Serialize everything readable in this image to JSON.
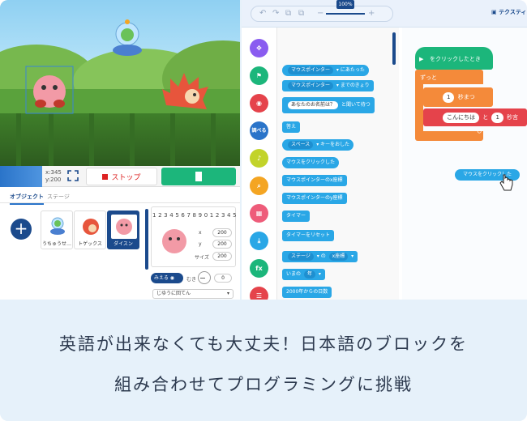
{
  "stage": {
    "coord_x": "x:345",
    "coord_y": "y:200",
    "stop_label": "ストップ"
  },
  "panel_tabs": [
    "オブジェクト",
    "ステージ"
  ],
  "sprites": [
    {
      "name": "うちゅうせ…"
    },
    {
      "name": "トゲックス"
    },
    {
      "name": "ダイスン"
    }
  ],
  "properties": {
    "digits": "1 2 3 4 5 6 7 8 9 0 1 2 3 4 5",
    "x_label": "x",
    "x_value": "200",
    "y_label": "y",
    "y_value": "200",
    "size_label": "サイズ",
    "size_value": "200",
    "show_label": "みえる",
    "direction_label": "むき",
    "direction_value": "0",
    "rotation_style": "じゆうに回てん"
  },
  "toolbar": {
    "zoom": "100%",
    "undo": "↶",
    "redo": "↷",
    "copy": "⧉",
    "minus": "−",
    "plus": "+",
    "text_mode": "テクスティ"
  },
  "categories": [
    {
      "label": "✥",
      "color": "#8a5cf0"
    },
    {
      "label": "⚑",
      "color": "#1cb67b"
    },
    {
      "label": "◉",
      "color": "#e5434b"
    },
    {
      "label": "調べる",
      "color": "#2a74c9"
    },
    {
      "label": "♪",
      "color": "#c2d32a"
    },
    {
      "label": "⌕",
      "color": "#f4a523"
    },
    {
      "label": "▦",
      "color": "#ee5c7a"
    },
    {
      "label": "⤓",
      "color": "#2aa7e6"
    },
    {
      "label": "fx",
      "color": "#1cb67b"
    },
    {
      "label": "☰",
      "color": "#e5434b"
    }
  ],
  "palette": {
    "b1_drop": "マウスポインター",
    "b1_text": "にあたった",
    "b2_drop": "マウスポインター",
    "b2_text": "までのきょり",
    "b3_slot": "あなたのお名前は？",
    "b3_text": "と聞いて待つ",
    "b4": "答え",
    "b5_drop": "スペース",
    "b5_text": "キーをおした",
    "b6": "マウスをクリックした",
    "b7": "マウスポインターのx座標",
    "b8": "マウスポインターのy座標",
    "b9": "タイマー",
    "b10": "タイマーをリセット",
    "b11_drop": "ステージ",
    "b11_of": "の",
    "b11_drop2": "x座標",
    "b12_pre": "いまの",
    "b12_drop": "年",
    "b13": "2000年からの日数"
  },
  "script": {
    "hat": "をクリックしたとき",
    "forever": "ずっと",
    "wait_value": "1",
    "wait_text": "秒まつ",
    "say_value": "こんにちは",
    "say_and": "と",
    "say_secs": "1",
    "say_tail": "秒言",
    "loop_arrow": "↺",
    "floating_block": "マウスをクリックした"
  },
  "caption": {
    "line1": "英語が出来なくても大丈夫！日本語のブロックを",
    "line2": "組み合わせてプログラミングに挑戦"
  }
}
